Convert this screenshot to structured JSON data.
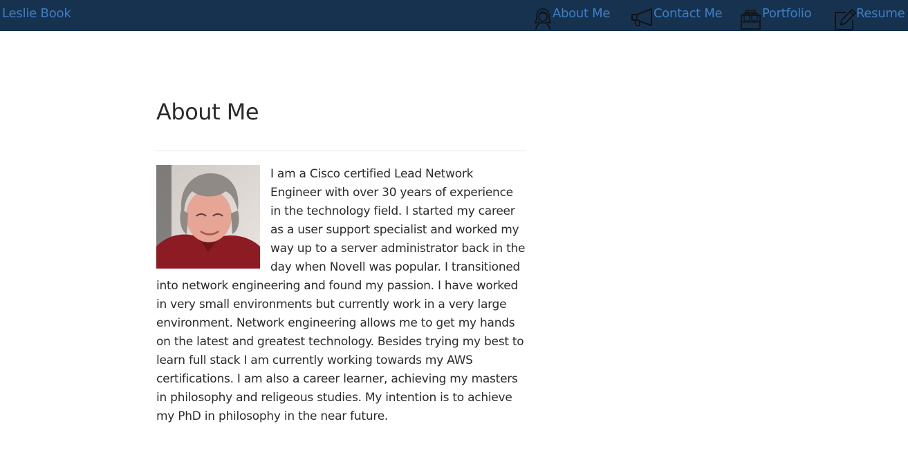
{
  "navbar": {
    "brand": "Leslie Book",
    "items": [
      {
        "label": "About Me",
        "icon": "woman-avatar-icon"
      },
      {
        "label": "Contact Me",
        "icon": "megaphone-icon"
      },
      {
        "label": "Portfolio",
        "icon": "briefcase-icon"
      },
      {
        "label": "Resume",
        "icon": "edit-pencil-icon"
      }
    ],
    "colors": {
      "background": "#16324f",
      "link": "#3d7fc4"
    }
  },
  "main": {
    "title": "About Me",
    "bio": "I am a Cisco certified Lead Network Engineer with over 30 years of experience in the technology field. I started my career as a user support specialist and worked my way up to a server administrator back in the day when Novell was popular. I transitioned into network engineering and found my passion. I have worked in very small environments but currently work in a very large environment. Network engineering allows me to get my hands on the latest and greatest technology. Besides trying my best to learn full stack I am currently working towards my AWS certifications. I am also a career learner, achieving my masters in philosophy and religeous studies. My intention is to achieve my PhD in philosophy in the near future."
  }
}
